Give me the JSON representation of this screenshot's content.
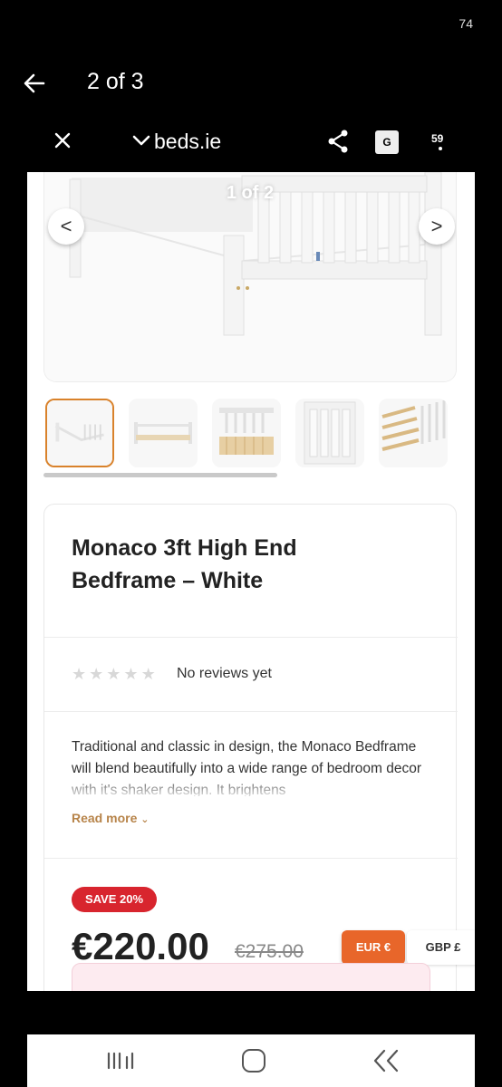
{
  "status_bar": {
    "number": "74"
  },
  "viewer": {
    "title": "2 of 3"
  },
  "browser": {
    "url": "beds.ie",
    "tabs_count": "59",
    "translate_label": "G"
  },
  "gallery": {
    "counter": "1 of 2",
    "prev_glyph": "<",
    "next_glyph": ">"
  },
  "product": {
    "title": "Monaco 3ft High End Bedframe – White",
    "reviews_text": "No reviews yet",
    "rating_stars": 0,
    "description": "Traditional and classic in design, the Monaco Bedframe will blend beautifully into a wide range of bedroom decor with it's shaker design. It brightens",
    "read_more": "Read more",
    "save_badge": "SAVE 20%",
    "price": "€220.00",
    "old_price": "€275.00",
    "currency_eur": "EUR €",
    "currency_gbp": "GBP £"
  },
  "colors": {
    "accent": "#e8662a",
    "save_red": "#d8252e",
    "read_more": "#b7844a"
  }
}
